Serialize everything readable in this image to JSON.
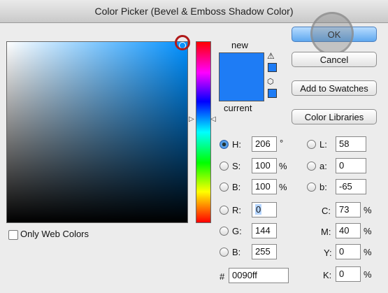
{
  "window": {
    "title": "Color Picker (Bevel & Emboss Shadow Color)"
  },
  "preview": {
    "new_label": "new",
    "current_label": "current",
    "new_color": "#1e7cf5",
    "current_color": "#1e7cf5"
  },
  "buttons": {
    "ok": "OK",
    "cancel": "Cancel",
    "add_swatches": "Add to Swatches",
    "color_libraries": "Color Libraries"
  },
  "web_colors": {
    "label": "Only Web Colors",
    "checked": false
  },
  "hsb": {
    "h": {
      "label": "H:",
      "value": "206",
      "unit": "°"
    },
    "s": {
      "label": "S:",
      "value": "100",
      "unit": "%"
    },
    "b": {
      "label": "B:",
      "value": "100",
      "unit": "%"
    }
  },
  "rgb": {
    "r": {
      "label": "R:",
      "value": "0"
    },
    "g": {
      "label": "G:",
      "value": "144"
    },
    "b": {
      "label": "B:",
      "value": "255"
    }
  },
  "lab": {
    "l": {
      "label": "L:",
      "value": "58"
    },
    "a": {
      "label": "a:",
      "value": "0"
    },
    "b": {
      "label": "b:",
      "value": "-65"
    }
  },
  "cmyk": {
    "c": {
      "label": "C:",
      "value": "73",
      "unit": "%"
    },
    "m": {
      "label": "M:",
      "value": "40",
      "unit": "%"
    },
    "y": {
      "label": "Y:",
      "value": "0",
      "unit": "%"
    },
    "k": {
      "label": "K:",
      "value": "0",
      "unit": "%"
    }
  },
  "hex": {
    "label": "#",
    "value": "0090ff"
  },
  "icons": {
    "warning": "warning-triangle-icon",
    "web_safe": "cube-icon"
  },
  "colors": {
    "field_hue": "#0090ff",
    "ok_accent": "#5fa8ef",
    "highlight": "#b01a1a"
  }
}
